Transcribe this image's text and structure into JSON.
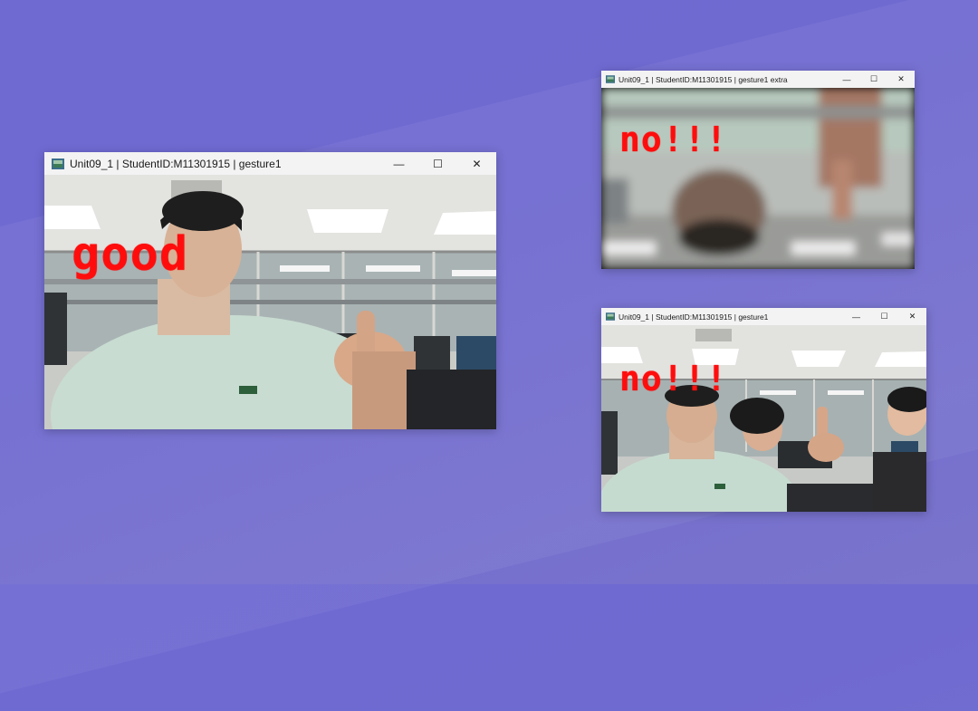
{
  "desktop": {
    "background_color": "#6e6ad2"
  },
  "windows": [
    {
      "title": "Unit09_1 | StudentID:M11301915 | gesture1",
      "overlay_text": "good",
      "overlay_color": "#ff0d0d",
      "controls": {
        "minimize": "—",
        "maximize": "☐",
        "close": "✕"
      }
    },
    {
      "title": "Unit09_1 | StudentID:M11301915 | gesture1 extra",
      "overlay_text": "no!!!",
      "overlay_color": "#ff0d0d",
      "controls": {
        "minimize": "—",
        "maximize": "☐",
        "close": "✕"
      }
    },
    {
      "title": "Unit09_1 | StudentID:M11301915 | gesture1",
      "overlay_text": "no!!!",
      "overlay_color": "#ff0d0d",
      "controls": {
        "minimize": "—",
        "maximize": "☐",
        "close": "✕"
      }
    }
  ]
}
